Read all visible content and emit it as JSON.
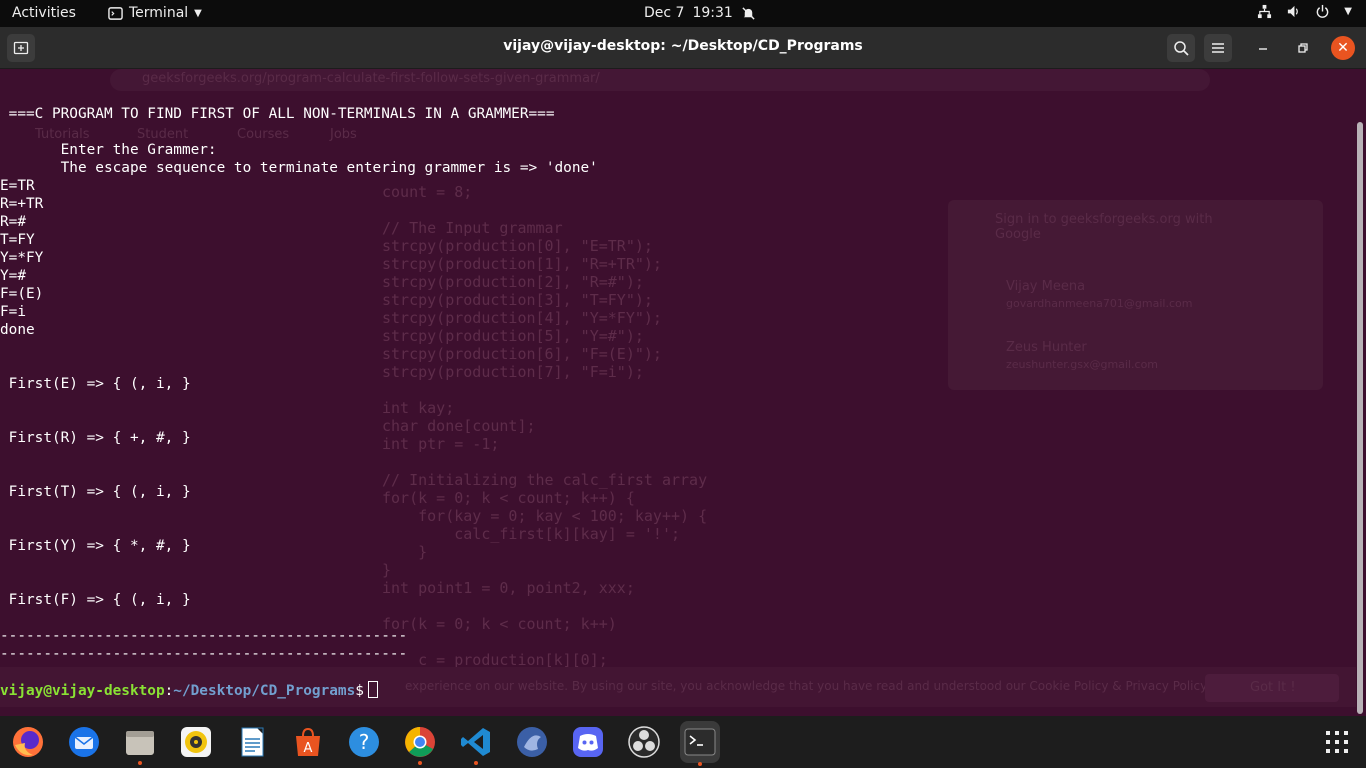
{
  "topbar": {
    "activities": "Activities",
    "app_name": "Terminal",
    "date": "Dec 7",
    "time": "19:31"
  },
  "window": {
    "title": "vijay@vijay-desktop: ~/Desktop/CD_Programs"
  },
  "terminal": {
    "lines": [
      " ===C PROGRAM TO FIND FIRST OF ALL NON-TERMINALS IN A GRAMMER===",
      "",
      "       Enter the Grammer:",
      "       The escape sequence to terminate entering grammer is => 'done'",
      "E=TR",
      "R=+TR",
      "R=#",
      "T=FY",
      "Y=*FY",
      "Y=#",
      "F=(E)",
      "F=i",
      "done",
      "",
      "",
      " First(E) => { (, i, }",
      "",
      "",
      " First(R) => { +, #, }",
      "",
      "",
      " First(T) => { (, i, }",
      "",
      "",
      " First(Y) => { *, #, }",
      "",
      "",
      " First(F) => { (, i, }",
      "",
      "-----------------------------------------------",
      "-----------------------------------------------"
    ],
    "prompt_user": "vijay@vijay-desktop",
    "prompt_sep": ":",
    "prompt_path": "~/Desktop/CD_Programs",
    "prompt_symbol": "$"
  },
  "background_browser": {
    "url": "geeksforgeeks.org/program-calculate-first-follow-sets-given-grammar/",
    "nav": [
      "Tutorials",
      "Student",
      "Courses",
      "Jobs"
    ],
    "code_lines": [
      "count = 8;",
      "",
      "// The Input grammar",
      "strcpy(production[0], \"E=TR\");",
      "strcpy(production[1], \"R=+TR\");",
      "strcpy(production[2], \"R=#\");",
      "strcpy(production[3], \"T=FY\");",
      "strcpy(production[4], \"Y=*FY\");",
      "strcpy(production[5], \"Y=#\");",
      "strcpy(production[6], \"F=(E)\");",
      "strcpy(production[7], \"F=i\");",
      "",
      "int kay;",
      "char done[count];",
      "int ptr = -1;",
      "",
      "// Initializing the calc_first array",
      "for(k = 0; k < count; k++) {",
      "    for(kay = 0; kay < 100; kay++) {",
      "        calc_first[k][kay] = '!';",
      "    }",
      "}",
      "int point1 = 0, point2, xxx;",
      "",
      "for(k = 0; k < count; k++)",
      "",
      "    c = production[k][0];"
    ],
    "signin_title": "Sign in to geeksforgeeks.org with Google",
    "accounts": [
      {
        "name": "Vijay Meena",
        "email": "govardhanmeena701@gmail.com"
      },
      {
        "name": "Zeus Hunter",
        "email": "zeushunter.gsx@gmail.com"
      }
    ],
    "cookie_text": "experience on our website. By using our site, you acknowledge that you have read and understood our Cookie Policy & Privacy Policy",
    "got_it": "Got It !"
  },
  "dock": {
    "apps": [
      "firefox-icon",
      "thunderbird-icon",
      "files-icon",
      "rhythmbox-icon",
      "writer-icon",
      "software-icon",
      "help-icon",
      "chrome-icon",
      "vscode-icon",
      "gnome-icon",
      "discord-icon",
      "obs-icon",
      "terminal-icon"
    ]
  },
  "colors": {
    "terminal_bg": "#3d0f2e",
    "prompt_user": "#8ae234",
    "prompt_path": "#729fcf",
    "accent": "#e95420"
  }
}
